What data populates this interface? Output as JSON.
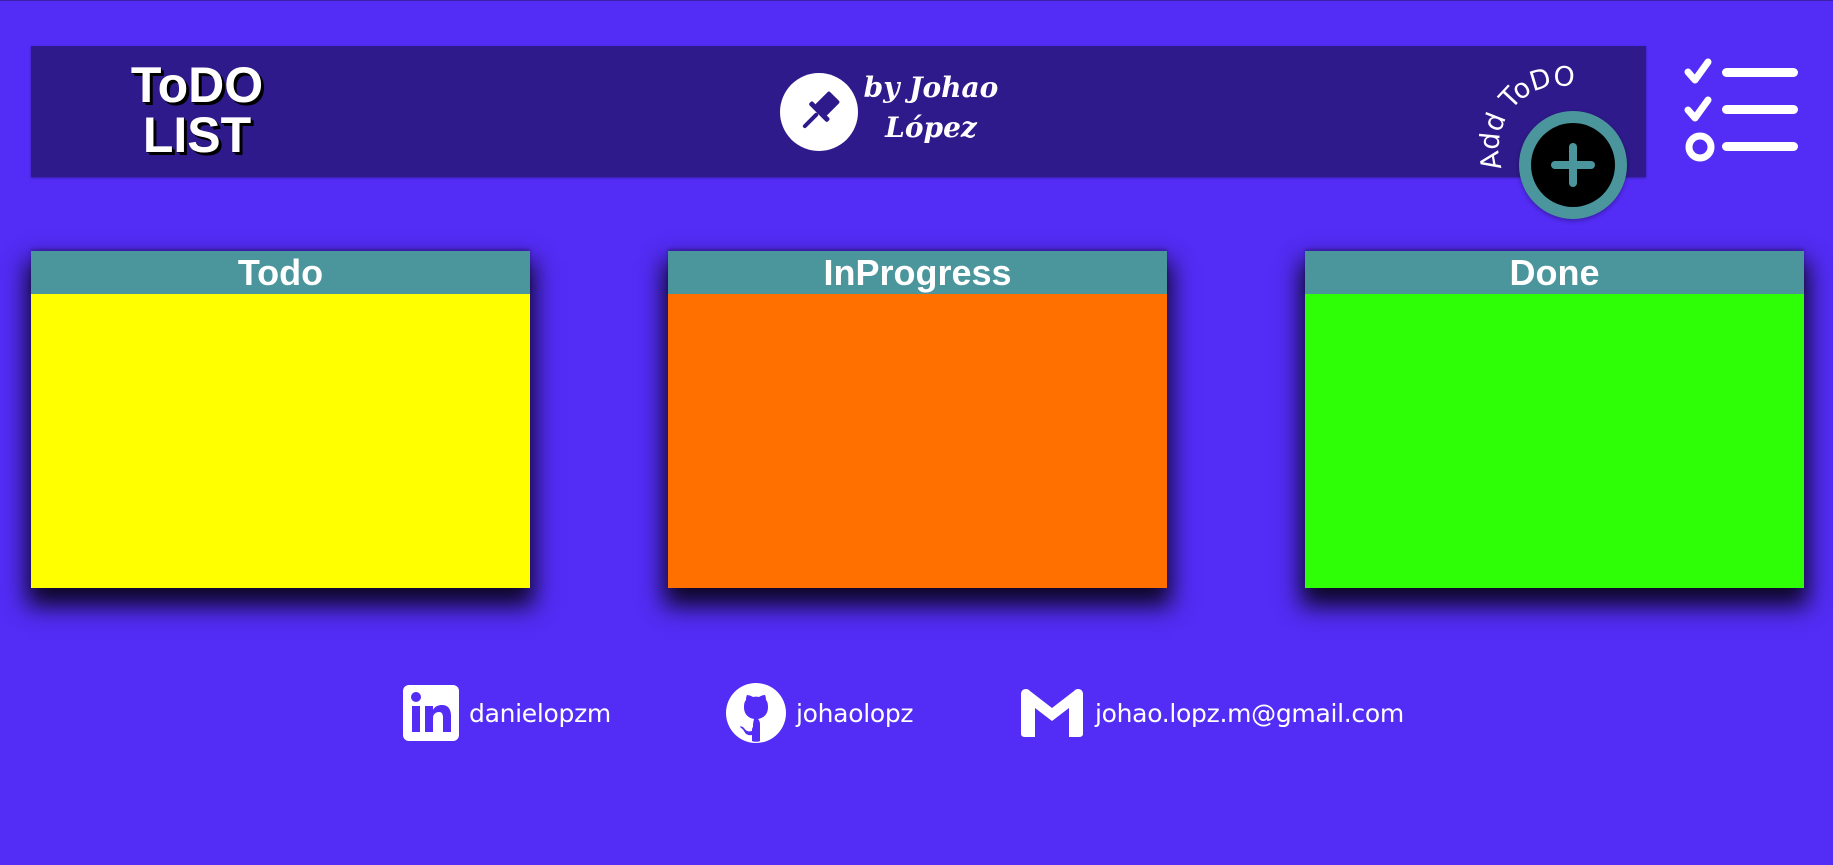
{
  "header": {
    "logo_line1": "ToDO",
    "logo_line2": "LIST",
    "author_line1": "by Johao",
    "author_line2": "López",
    "add_button_label": "Add ToDO"
  },
  "columns": [
    {
      "title": "Todo",
      "color": "#ffff00"
    },
    {
      "title": "InProgress",
      "color": "#ff7000"
    },
    {
      "title": "Done",
      "color": "#2eff07"
    }
  ],
  "footer": {
    "linkedin": "danielopzm",
    "github": "johaolopz",
    "email": "johao.lopz.m@gmail.com"
  },
  "icons": {
    "author": "pushpin-icon",
    "add": "plus-icon",
    "menu": "checklist-menu-icon",
    "linkedin": "linkedin-icon",
    "github": "github-icon",
    "email": "gmail-icon"
  },
  "colors": {
    "background": "#532cf5",
    "header": "#2e1a8a",
    "column_header": "#4a969c"
  }
}
